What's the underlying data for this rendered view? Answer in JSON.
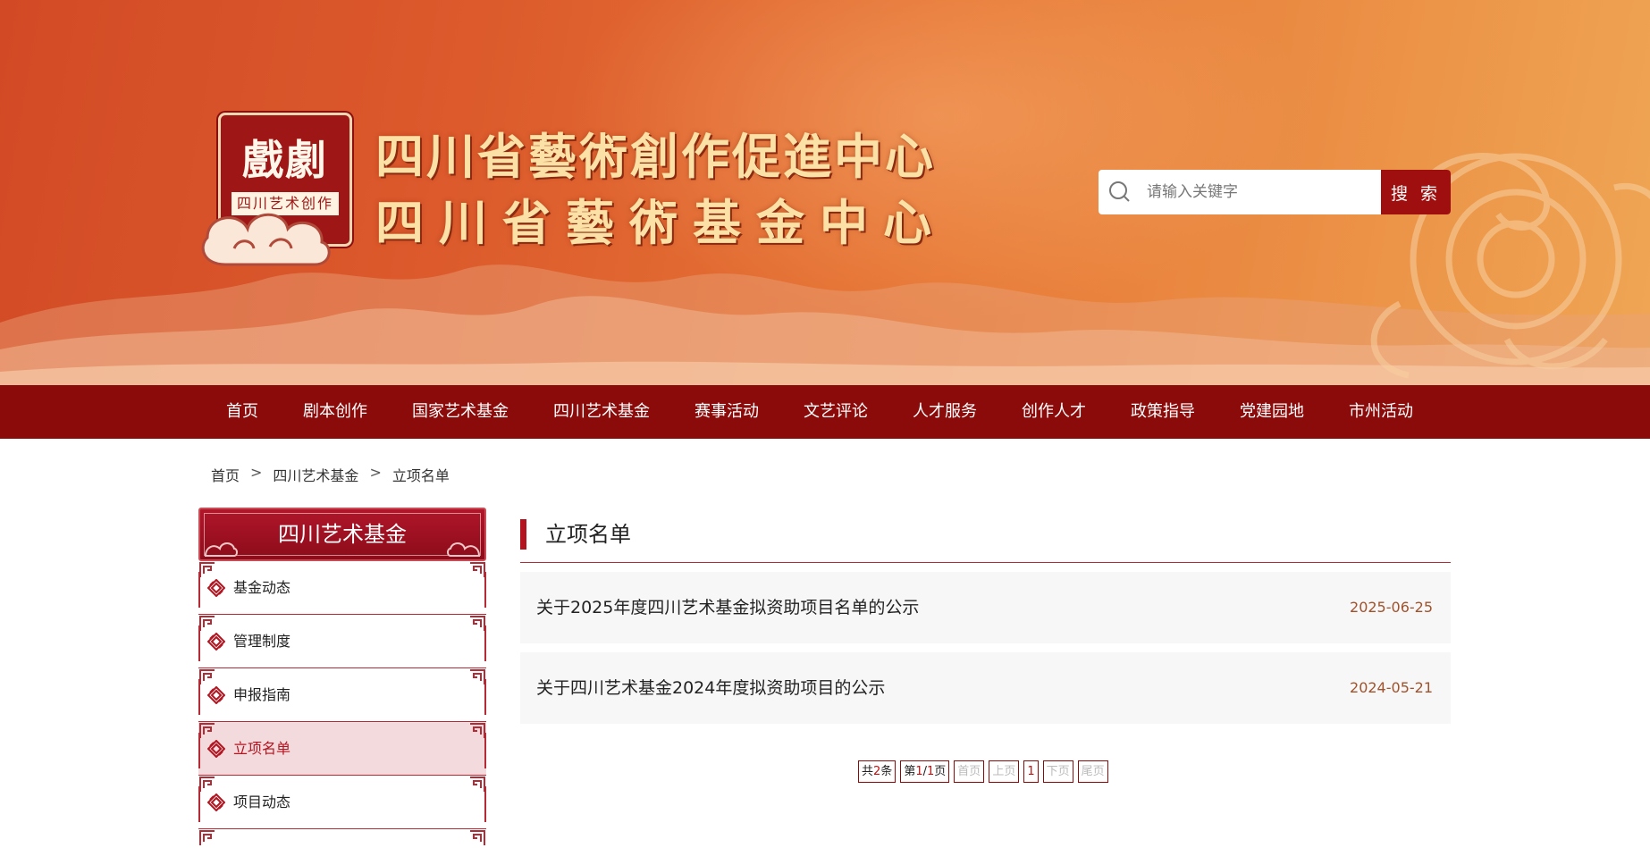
{
  "header": {
    "seal_text": "戲劇",
    "seal_subtitle": "四川艺术创作",
    "brand_line1": "四川省藝術創作促進中心",
    "brand_line2": "四川省藝術基金中心",
    "search": {
      "placeholder": "请输入关键字",
      "button_label": "搜 索",
      "icon": "search-icon"
    }
  },
  "nav": {
    "items": [
      "首页",
      "剧本创作",
      "国家艺术基金",
      "四川艺术基金",
      "赛事活动",
      "文艺评论",
      "人才服务",
      "创作人才",
      "政策指导",
      "党建园地",
      "市州活动"
    ]
  },
  "breadcrumb": {
    "items": [
      "首页",
      "四川艺术基金",
      "立项名单"
    ],
    "separator": ">"
  },
  "sidebar": {
    "title": "四川艺术基金",
    "items": [
      {
        "label": "基金动态",
        "active": false
      },
      {
        "label": "管理制度",
        "active": false
      },
      {
        "label": "申报指南",
        "active": false
      },
      {
        "label": "立项名单",
        "active": true
      },
      {
        "label": "项目动态",
        "active": false
      }
    ]
  },
  "main": {
    "section_title": "立项名单",
    "articles": [
      {
        "title": "关于2025年度四川艺术基金拟资助项目名单的公示",
        "date": "2025-06-25"
      },
      {
        "title": "关于四川艺术基金2024年度拟资助项目的公示",
        "date": "2024-05-21"
      }
    ],
    "pagination": {
      "total_prefix": "共",
      "total_count": "2",
      "total_suffix": "条",
      "page_prefix": "第",
      "page_current": "1",
      "page_sep": "/",
      "page_total": "1",
      "page_suffix": "页",
      "first": "首页",
      "prev": "上页",
      "current": "1",
      "next": "下页",
      "last": "尾页"
    }
  },
  "colors": {
    "nav_bg": "#8b0a0a",
    "accent_red": "#b3141f",
    "date": "#a0522d",
    "banner_start": "#d24a25",
    "banner_end": "#efa654"
  }
}
